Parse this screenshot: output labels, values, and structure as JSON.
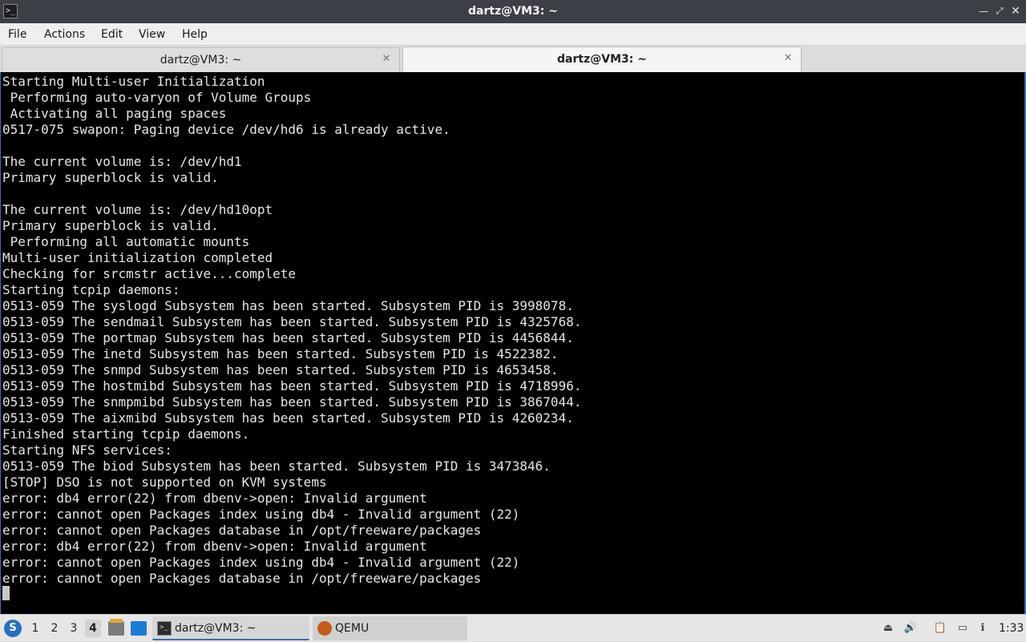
{
  "window": {
    "title": "dartz@VM3: ~",
    "app_icon_glyph": ">_",
    "buttons": {
      "minimize": "—",
      "maximize": "⤢",
      "close": "✕"
    }
  },
  "menubar": {
    "items": [
      "File",
      "Actions",
      "Edit",
      "View",
      "Help"
    ]
  },
  "tabs": [
    {
      "label": "dartz@VM3: ~",
      "active": false,
      "close": "✕"
    },
    {
      "label": "dartz@VM3: ~",
      "active": true,
      "close": "✕"
    }
  ],
  "terminal": {
    "lines": [
      "Starting Multi-user Initialization",
      " Performing auto-varyon of Volume Groups",
      " Activating all paging spaces",
      "0517-075 swapon: Paging device /dev/hd6 is already active.",
      "",
      "The current volume is: /dev/hd1",
      "Primary superblock is valid.",
      "",
      "The current volume is: /dev/hd10opt",
      "Primary superblock is valid.",
      " Performing all automatic mounts",
      "Multi-user initialization completed",
      "Checking for srcmstr active...complete",
      "Starting tcpip daemons:",
      "0513-059 The syslogd Subsystem has been started. Subsystem PID is 3998078.",
      "0513-059 The sendmail Subsystem has been started. Subsystem PID is 4325768.",
      "0513-059 The portmap Subsystem has been started. Subsystem PID is 4456844.",
      "0513-059 The inetd Subsystem has been started. Subsystem PID is 4522382.",
      "0513-059 The snmpd Subsystem has been started. Subsystem PID is 4653458.",
      "0513-059 The hostmibd Subsystem has been started. Subsystem PID is 4718996.",
      "0513-059 The snmpmibd Subsystem has been started. Subsystem PID is 3867044.",
      "0513-059 The aixmibd Subsystem has been started. Subsystem PID is 4260234.",
      "Finished starting tcpip daemons.",
      "Starting NFS services:",
      "0513-059 The biod Subsystem has been started. Subsystem PID is 3473846.",
      "[STOP] DSO is not supported on KVM systems",
      "error: db4 error(22) from dbenv->open: Invalid argument",
      "error: cannot open Packages index using db4 - Invalid argument (22)",
      "error: cannot open Packages database in /opt/freeware/packages",
      "error: db4 error(22) from dbenv->open: Invalid argument",
      "error: cannot open Packages index using db4 - Invalid argument (22)",
      "error: cannot open Packages database in /opt/freeware/packages"
    ]
  },
  "taskbar": {
    "workspaces": [
      "1",
      "2",
      "3",
      "4"
    ],
    "current_workspace": "4",
    "tasks": [
      {
        "label": "dartz@VM3: ~",
        "icon": "terminal-icon"
      },
      {
        "label": "QEMU",
        "icon": "qemu-icon"
      }
    ],
    "tray_icons": [
      "eject-icon",
      "volume-icon",
      "clipboard-icon",
      "network-icon",
      "notification-icon"
    ],
    "clock": "1:33"
  },
  "colors": {
    "terminal_bg": "#000000",
    "terminal_fg": "#e6e6e6",
    "accent": "#3a6fb0"
  }
}
